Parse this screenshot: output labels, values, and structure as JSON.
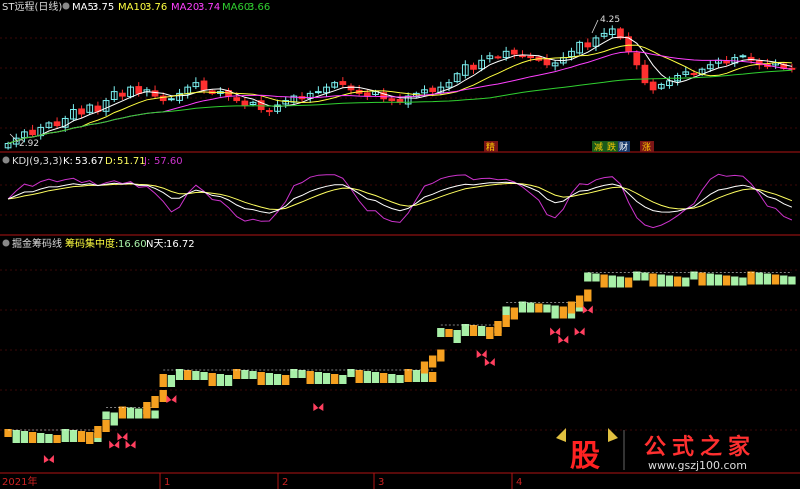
{
  "colors": {
    "bg": "#000000",
    "grid": "#7a1010",
    "panel_border": "#b01515",
    "up": "#7cf0f0",
    "down": "#ff3030",
    "ma5": "#ffffff",
    "ma10": "#ffff40",
    "ma20": "#ff40ff",
    "ma60": "#30d030",
    "k": "#ffffff",
    "d": "#ffff60",
    "j": "#cc33cc",
    "chip_green": "#a8f0a8",
    "chip_orange": "#f5a020",
    "signal": "#ff4060",
    "header_text": "#dddddd"
  },
  "top_panel": {
    "title": "ST远程(日线)",
    "ma5_label": "MA5:",
    "ma5_value": "3.75",
    "ma10_label": "MA10:",
    "ma10_value": "3.76",
    "ma20_label": "MA20:",
    "ma20_value": "3.74",
    "ma60_label": "MA60:",
    "ma60_value": "3.66",
    "high_marker": "4.25",
    "low_marker": "2.92",
    "event_tags": [
      "精",
      "减",
      "跌",
      "财",
      "涨"
    ]
  },
  "kdj_panel": {
    "title": "KDJ(9,3,3)",
    "k_label": "K:",
    "k_value": "53.67",
    "d_label": "D:",
    "d_value": "51.71",
    "j_label": "J:",
    "j_value": "57.60"
  },
  "chip_panel": {
    "title": "掘金筹码线",
    "conc_label": "筹码集中度:",
    "conc_value": "16.60",
    "n_label": "N天:",
    "n_value": "16.72"
  },
  "x_axis": {
    "labels": [
      "2021年",
      "1",
      "2",
      "3",
      "4"
    ]
  },
  "watermark": {
    "logo_char": "股",
    "text": "公式之家",
    "url": "www.gszj100.com"
  },
  "chart_data": {
    "type": "candlestick",
    "price_low": 2.92,
    "price_high": 4.25,
    "ma_latest": {
      "MA5": 3.75,
      "MA10": 3.76,
      "MA20": 3.74,
      "MA60": 3.66
    },
    "kdj_latest": {
      "K": 53.67,
      "D": 51.71,
      "J": 57.6
    },
    "chip_latest": {
      "concentration": 16.6,
      "N": 16.72
    },
    "close": [
      2.92,
      2.98,
      3.05,
      3.02,
      3.1,
      3.15,
      3.12,
      3.2,
      3.3,
      3.25,
      3.35,
      3.28,
      3.4,
      3.5,
      3.45,
      3.55,
      3.48,
      3.52,
      3.45,
      3.4,
      3.42,
      3.48,
      3.55,
      3.6,
      3.52,
      3.48,
      3.5,
      3.45,
      3.4,
      3.35,
      3.38,
      3.3,
      3.28,
      3.35,
      3.4,
      3.45,
      3.42,
      3.48,
      3.5,
      3.55,
      3.6,
      3.58,
      3.52,
      3.48,
      3.45,
      3.5,
      3.42,
      3.4,
      3.38,
      3.45,
      3.48,
      3.52,
      3.5,
      3.55,
      3.6,
      3.7,
      3.8,
      3.75,
      3.85,
      3.9,
      3.88,
      3.95,
      3.92,
      3.9,
      3.88,
      3.85,
      3.8,
      3.82,
      3.88,
      3.95,
      4.05,
      4.0,
      4.1,
      4.15,
      4.2,
      4.1,
      3.95,
      3.8,
      3.6,
      3.52,
      3.58,
      3.62,
      3.68,
      3.72,
      3.7,
      3.75,
      3.8,
      3.85,
      3.82,
      3.88,
      3.9,
      3.85,
      3.8,
      3.78,
      3.82,
      3.76,
      3.75
    ],
    "chip_levels": [
      {
        "from": 0,
        "to": 11,
        "level": 3.1,
        "color": "mixed"
      },
      {
        "from": 12,
        "to": 18,
        "level": 3.25,
        "color": "mixed"
      },
      {
        "from": 19,
        "to": 52,
        "level": 3.5,
        "color": "mixed"
      },
      {
        "from": 53,
        "to": 60,
        "level": 3.8,
        "color": "mixed"
      },
      {
        "from": 61,
        "to": 70,
        "level": 3.95,
        "color": "mixed"
      },
      {
        "from": 71,
        "to": 96,
        "level": 4.15,
        "color": "mixed"
      }
    ]
  }
}
